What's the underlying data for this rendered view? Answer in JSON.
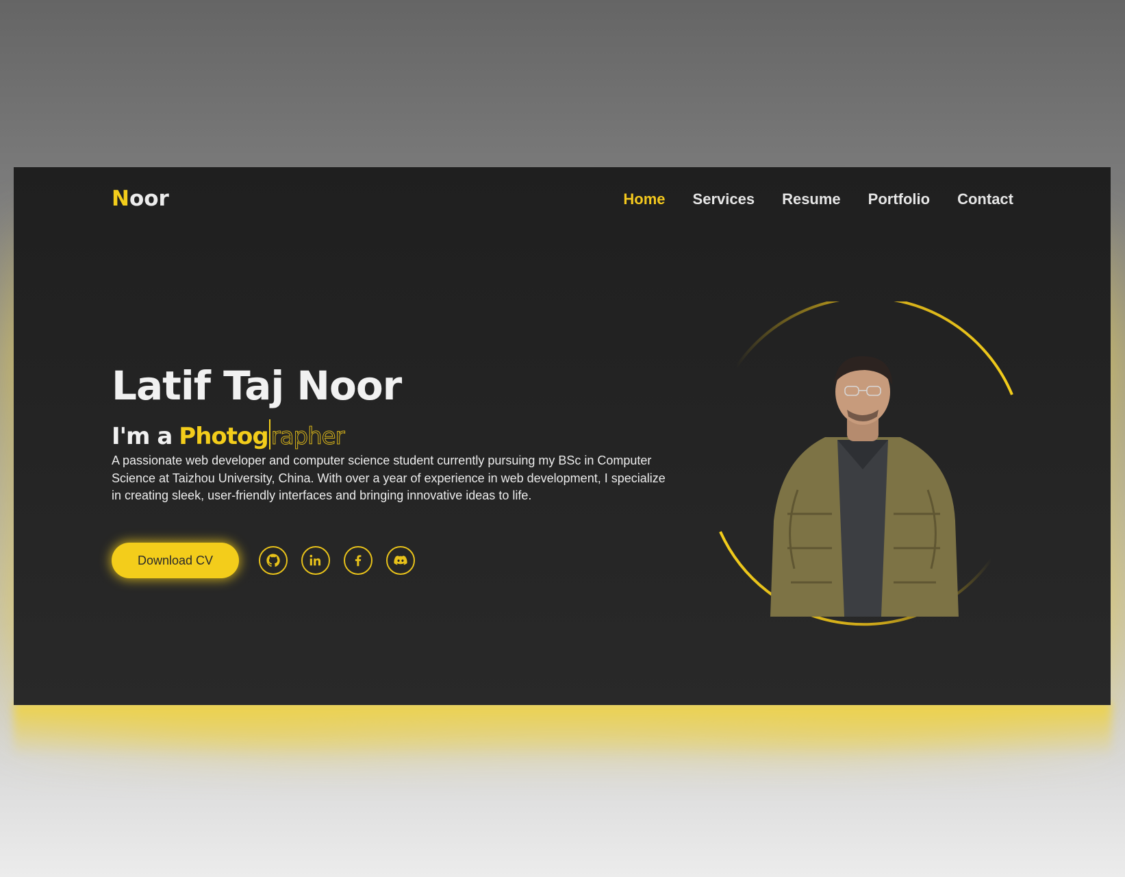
{
  "nav": {
    "logo_first": "N",
    "logo_rest": "oor",
    "links": [
      "Home",
      "Services",
      "Resume",
      "Portfolio",
      "Contact"
    ],
    "active": "Home"
  },
  "hero": {
    "name": "Latif Taj Noor",
    "role_prefix": "I'm a",
    "role_typed": "Photog",
    "role_ghost": "rapher",
    "description": "A passionate web developer and computer science student currently pursuing my BSc in Computer Science at Taizhou University, China. With over a year of experience in web development, I specialize in creating sleek, user-friendly interfaces and bringing innovative ideas to life.",
    "cv_label": "Download CV"
  },
  "socials": [
    "github-icon",
    "linkedin-icon",
    "facebook-icon",
    "discord-icon"
  ],
  "colors": {
    "accent": "#f3cd1b",
    "background": "#232323",
    "text": "#ececec"
  }
}
